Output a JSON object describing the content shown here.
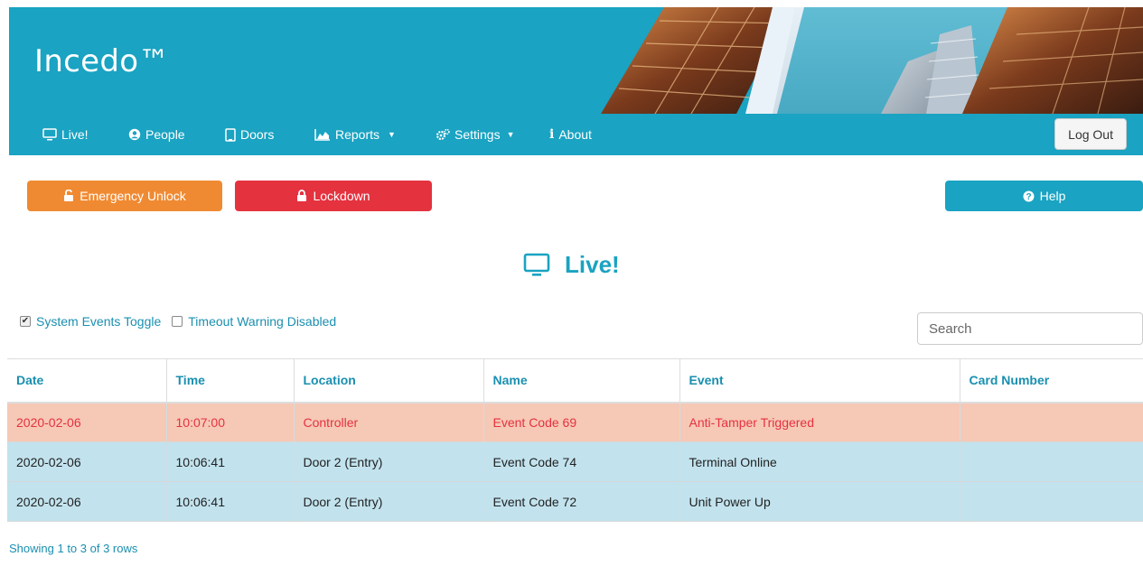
{
  "app": {
    "brand": "Incedo™"
  },
  "nav": {
    "items": [
      {
        "label": "Live!",
        "icon": "monitor-icon"
      },
      {
        "label": "People",
        "icon": "user-circle-icon"
      },
      {
        "label": "Doors",
        "icon": "door-icon"
      },
      {
        "label": "Reports",
        "icon": "area-chart-icon",
        "dropdown": true
      },
      {
        "label": "Settings",
        "icon": "cogs-icon",
        "dropdown": true
      },
      {
        "label": "About",
        "icon": "info-icon"
      }
    ],
    "logout_label": "Log Out"
  },
  "actions": {
    "emergency_unlock": "Emergency Unlock",
    "lockdown": "Lockdown",
    "help": "Help"
  },
  "page": {
    "title": "Live!"
  },
  "toggles": {
    "system_events": {
      "label": "System Events Toggle",
      "checked": true
    },
    "timeout_warning": {
      "label": "Timeout Warning Disabled",
      "checked": false
    }
  },
  "search": {
    "placeholder": "Search"
  },
  "table": {
    "columns": [
      "Date",
      "Time",
      "Location",
      "Name",
      "Event",
      "Card Number"
    ],
    "rows": [
      {
        "status": "danger",
        "cells": [
          "2020-02-06",
          "10:07:00",
          "Controller",
          "Event Code 69",
          "Anti-Tamper Triggered",
          ""
        ]
      },
      {
        "status": "info",
        "cells": [
          "2020-02-06",
          "10:06:41",
          "Door 2 (Entry)",
          "Event Code 74",
          "Terminal Online",
          ""
        ]
      },
      {
        "status": "info",
        "cells": [
          "2020-02-06",
          "10:06:41",
          "Door 2 (Entry)",
          "Event Code 72",
          "Unit Power Up",
          ""
        ]
      }
    ],
    "footer": "Showing 1 to 3 of 3 rows"
  },
  "colors": {
    "primary": "#1aa3c2",
    "warning": "#f08a32",
    "danger": "#e5323f",
    "row_danger": "#f6c8b6",
    "row_info": "#c2e3ee"
  }
}
